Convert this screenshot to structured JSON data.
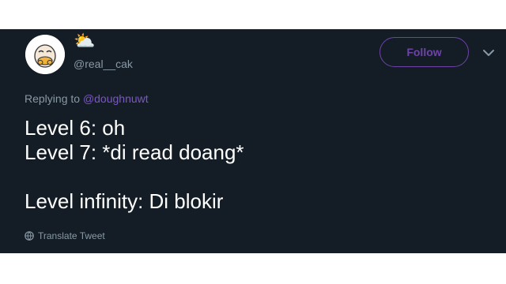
{
  "tweet": {
    "display_name_emoji": "⛅",
    "handle": "@real__cak",
    "follow_label": "Follow",
    "reply_prefix": "Replying to",
    "reply_to": "@doughnuwt",
    "text_lines": [
      "Level 6: oh",
      "Level 7: *di read doang*",
      "",
      "Level infinity: Di blokir"
    ],
    "translate_label": "Translate Tweet"
  },
  "colors": {
    "card_background": "#141d26",
    "accent_purple": "#6e43a8",
    "muted_text": "#8899a6",
    "primary_text": "#ffffff"
  },
  "icons": {
    "avatar": "cartoon-face-avatar",
    "caret": "chevron-down-icon",
    "translate": "globe-icon"
  }
}
